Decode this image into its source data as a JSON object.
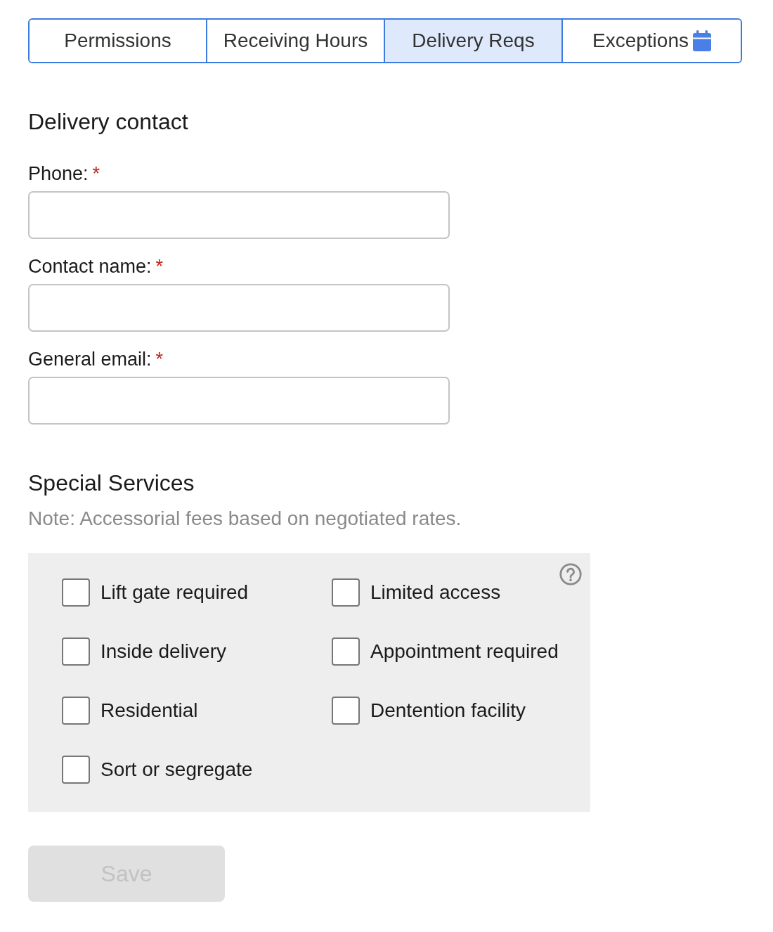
{
  "tabs": [
    {
      "label": "Permissions",
      "selected": false,
      "icon": false
    },
    {
      "label": "Receiving Hours",
      "selected": false,
      "icon": false
    },
    {
      "label": "Delivery Reqs",
      "selected": true,
      "icon": false
    },
    {
      "label": "Exceptions",
      "selected": false,
      "icon": true
    }
  ],
  "delivery_contact": {
    "title": "Delivery contact",
    "fields": [
      {
        "label": "Phone:",
        "required_mark": "*"
      },
      {
        "label": "Contact name:",
        "required_mark": "*"
      },
      {
        "label": "General email:",
        "required_mark": "*"
      }
    ]
  },
  "special_services": {
    "title": "Special Services",
    "note": "Note: Accessorial fees based on negotiated rates.",
    "options": [
      {
        "label": "Lift gate required",
        "checked": false
      },
      {
        "label": "Limited access",
        "checked": false
      },
      {
        "label": "Inside delivery",
        "checked": false
      },
      {
        "label": "Appointment required",
        "checked": false
      },
      {
        "label": "Residential",
        "checked": false
      },
      {
        "label": "Dentention facility",
        "checked": false
      },
      {
        "label": "Sort or segregate",
        "checked": false
      }
    ]
  },
  "save_button": {
    "label": "Save",
    "disabled": true
  }
}
